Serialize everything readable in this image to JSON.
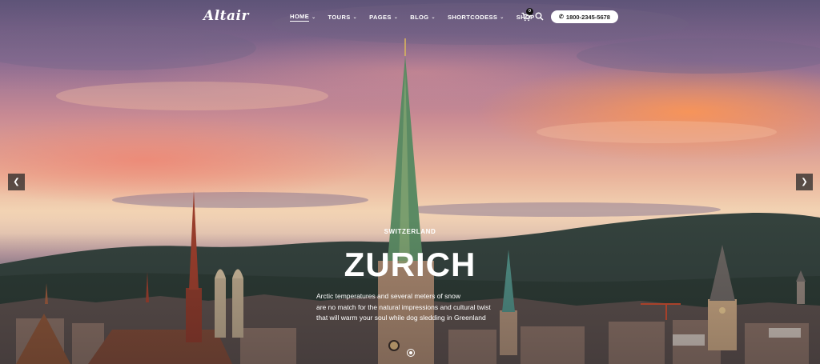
{
  "header": {
    "logo": "Altair",
    "nav": [
      {
        "label": "HOME",
        "active": true,
        "has_dropdown": true
      },
      {
        "label": "TOURS",
        "active": false,
        "has_dropdown": true
      },
      {
        "label": "PAGES",
        "active": false,
        "has_dropdown": true
      },
      {
        "label": "BLOG",
        "active": false,
        "has_dropdown": true
      },
      {
        "label": "SHORTCODESS",
        "active": false,
        "has_dropdown": true
      },
      {
        "label": "SHOP",
        "active": false,
        "has_dropdown": false
      }
    ],
    "cart_count": "0",
    "phone": "1800-2345-5678"
  },
  "slide": {
    "subtitle": "SWITZERLAND",
    "title": "ZURICH",
    "description_lines": [
      "Arctic temperatures and several meters of snow",
      "are no match for the natural impressions and cultural twist",
      "that will warm your soul while dog sledding in Greenland"
    ]
  },
  "slider": {
    "prev_icon": "chevron-left-icon",
    "next_icon": "chevron-right-icon"
  },
  "colors": {
    "accent_text": "#ffffff",
    "pill_bg": "#ffffff",
    "arrow_bg": "#282828"
  }
}
